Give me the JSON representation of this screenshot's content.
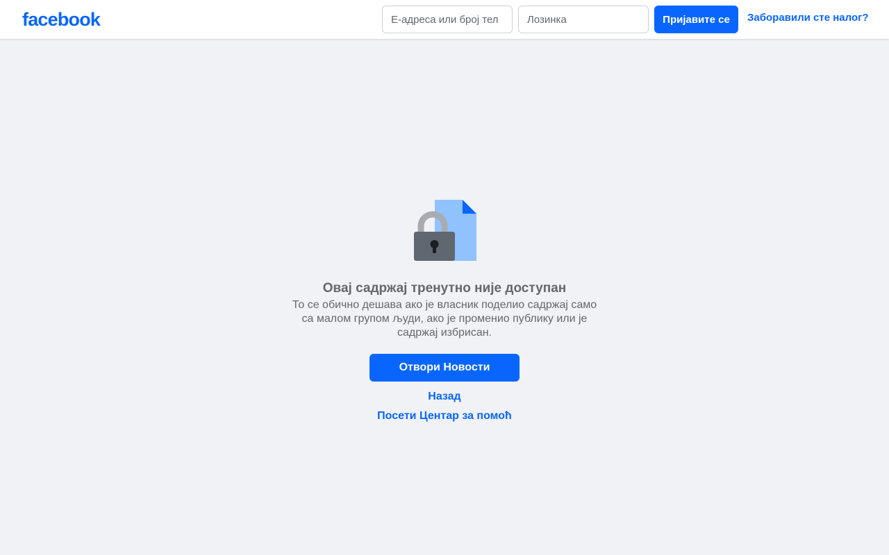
{
  "header": {
    "logo_text": "facebook",
    "email_placeholder": "Е-адреса или број тел",
    "password_placeholder": "Лозинка",
    "login_button": "Пријавите се",
    "forgot_link": "Заборавили сте налог?"
  },
  "main": {
    "illustration_icon": "locked-document-icon",
    "title": "Овај садржај тренутно није доступан",
    "description": "То се обично дешава ако је власник поделио садржај само са малом групом људи, ако је променио публику или је садржај избрисан.",
    "feed_button": "Отвори Новости",
    "back_link": "Назад",
    "help_link": "Посети Центар за помоћ"
  },
  "colors": {
    "brand": "#0866ff",
    "background": "#f0f2f5",
    "text_secondary": "#65676b"
  }
}
